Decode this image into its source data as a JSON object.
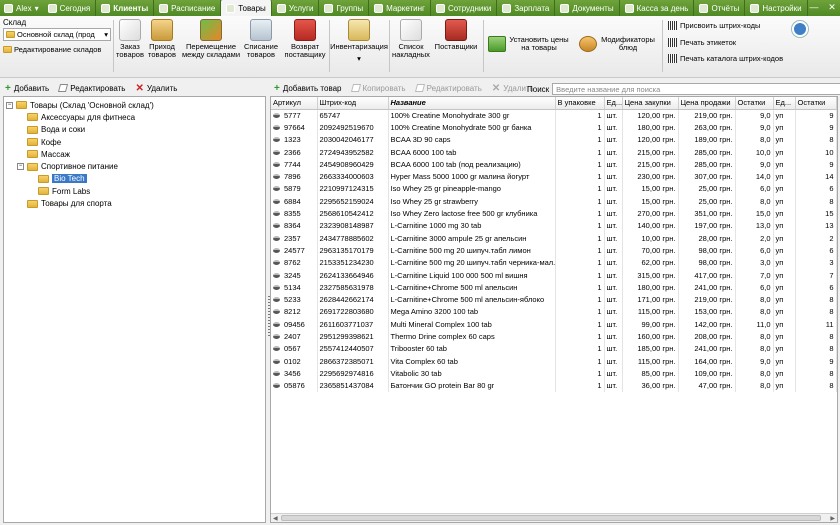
{
  "topbar": {
    "user": "Alex",
    "tabs": [
      {
        "label": "Сегодня",
        "bold": false,
        "active": false
      },
      {
        "label": "Клиенты",
        "bold": true,
        "active": false
      },
      {
        "label": "Расписание",
        "bold": false,
        "active": false
      },
      {
        "label": "Товары",
        "bold": false,
        "active": true
      },
      {
        "label": "Услуги",
        "bold": false,
        "active": false
      },
      {
        "label": "Группы",
        "bold": false,
        "active": false
      },
      {
        "label": "Маркетинг",
        "bold": false,
        "active": false
      },
      {
        "label": "Сотрудники",
        "bold": false,
        "active": false
      },
      {
        "label": "Зарплата",
        "bold": false,
        "active": false
      },
      {
        "label": "Документы",
        "bold": false,
        "active": false
      },
      {
        "label": "Касса за день",
        "bold": false,
        "active": false
      },
      {
        "label": "Отчёты",
        "bold": false,
        "active": false
      },
      {
        "label": "Настройки",
        "bold": false,
        "active": false
      }
    ]
  },
  "ribbon": {
    "sklad_label": "Склад",
    "sklad_value": "Основной склад (прод",
    "edit_sklad": "Редактирование складов",
    "buttons": {
      "order": "Заказ товаров",
      "income": "Приход товаров",
      "move": "Перемещение между складами",
      "writeoff": "Списание товаров",
      "return": "Возврат поставщику",
      "inventory": "Инвентаризация",
      "waybills": "Список накладных",
      "suppliers": "Поставщики",
      "setprices": "Установить цены на товары",
      "modifiers": "Модификаторы блюд"
    },
    "barcode_assign": "Присвоить штрих-коды",
    "print_labels": "Печать этикеток",
    "print_catalog": "Печать каталога штрих-кодов"
  },
  "left_toolbar": {
    "add": "Добавить",
    "edit": "Редактировать",
    "delete": "Удалить"
  },
  "right_toolbar": {
    "add": "Добавить товар",
    "copy": "Копировать",
    "edit": "Редактировать",
    "delete": "Удалить"
  },
  "search": {
    "label": "Поиск",
    "placeholder": "Введите название для поиска"
  },
  "tree": [
    {
      "label": "Товары (Склад 'Основной склад')",
      "level": 0,
      "exp": "−",
      "selected": false
    },
    {
      "label": "Аксессуары для фитнеса",
      "level": 1,
      "exp": "",
      "selected": false
    },
    {
      "label": "Вода и соки",
      "level": 1,
      "exp": "",
      "selected": false
    },
    {
      "label": "Кофе",
      "level": 1,
      "exp": "",
      "selected": false
    },
    {
      "label": "Массаж",
      "level": 1,
      "exp": "",
      "selected": false
    },
    {
      "label": "Спортивное питание",
      "level": 1,
      "exp": "−",
      "selected": false
    },
    {
      "label": "Bio Tech",
      "level": 2,
      "exp": "",
      "selected": true
    },
    {
      "label": "Form Labs",
      "level": 2,
      "exp": "",
      "selected": false
    },
    {
      "label": "Товары для спорта",
      "level": 1,
      "exp": "",
      "selected": false
    }
  ],
  "table": {
    "headers": [
      "Артикул",
      "Штрих-код",
      "Название",
      "В упаковке",
      "Ед...",
      "Цена закупки",
      "Цена продажи",
      "Остатки",
      "Ед...",
      "Остатки"
    ],
    "rows": [
      [
        "5777",
        "65747",
        "100% Creatine Monohydrate 300 gr",
        "1",
        "шт.",
        "120,00 грн.",
        "219,00 грн.",
        "9,0",
        "уп",
        "9"
      ],
      [
        "97664",
        "2092492519670",
        "100% Creatine Monohydrate 500 gr банка",
        "1",
        "шт.",
        "180,00 грн.",
        "263,00 грн.",
        "9,0",
        "уп",
        "9"
      ],
      [
        "1323",
        "2030042046177",
        "BCAA 3D 90 caps",
        "1",
        "шт.",
        "120,00 грн.",
        "189,00 грн.",
        "8,0",
        "уп",
        "8"
      ],
      [
        "2366",
        "2724943952582",
        "BCAA 6000 100 tab",
        "1",
        "шт.",
        "215,00 грн.",
        "285,00 грн.",
        "10,0",
        "уп",
        "10"
      ],
      [
        "7744",
        "2454908960429",
        "BCAA 6000 100 tab (под реализацию)",
        "1",
        "шт.",
        "215,00 грн.",
        "285,00 грн.",
        "9,0",
        "уп",
        "9"
      ],
      [
        "7896",
        "2663334000603",
        "Hyper Mass 5000 1000 gr малина йогурт",
        "1",
        "шт.",
        "230,00 грн.",
        "307,00 грн.",
        "14,0",
        "уп",
        "14"
      ],
      [
        "5879",
        "2210997124315",
        "Iso Whey 25 gr pineapple-mango",
        "1",
        "шт.",
        "15,00 грн.",
        "25,00 грн.",
        "6,0",
        "уп",
        "6"
      ],
      [
        "6884",
        "2295652159024",
        "Iso Whey 25 gr strawberry",
        "1",
        "шт.",
        "15,00 грн.",
        "25,00 грн.",
        "8,0",
        "уп",
        "8"
      ],
      [
        "8355",
        "2568610542412",
        "Iso Whey Zero lactose free 500 gr клубника",
        "1",
        "шт.",
        "270,00 грн.",
        "351,00 грн.",
        "15,0",
        "уп",
        "15"
      ],
      [
        "8364",
        "2323908148987",
        "L-Carnitine 1000 mg 30 tab",
        "1",
        "шт.",
        "140,00 грн.",
        "197,00 грн.",
        "13,0",
        "уп",
        "13"
      ],
      [
        "2357",
        "2434778885602",
        "L-Carnitine 3000 ampule 25 gr апельсин",
        "1",
        "шт.",
        "10,00 грн.",
        "28,00 грн.",
        "2,0",
        "уп",
        "2"
      ],
      [
        "24577",
        "2963135170179",
        "L-Carnitine 500 mg 20 шипуч.табл лимон",
        "1",
        "шт.",
        "70,00 грн.",
        "98,00 грн.",
        "6,0",
        "уп",
        "6"
      ],
      [
        "8762",
        "2153351234230",
        "L-Carnitine 500 mg 20 шипуч.табл черника-мал...",
        "1",
        "шт.",
        "62,00 грн.",
        "98,00 грн.",
        "3,0",
        "уп",
        "3"
      ],
      [
        "3245",
        "2624133664946",
        "L-Carnitine Liquid 100 000 500 ml вишня",
        "1",
        "шт.",
        "315,00 грн.",
        "417,00 грн.",
        "7,0",
        "уп",
        "7"
      ],
      [
        "5134",
        "2327585631978",
        "L-Carnitine+Chrome 500 ml апельсин",
        "1",
        "шт.",
        "180,00 грн.",
        "241,00 грн.",
        "6,0",
        "уп",
        "6"
      ],
      [
        "5233",
        "2628442662174",
        "L-Carnitine+Chrome 500 ml апельсин-яблоко",
        "1",
        "шт.",
        "171,00 грн.",
        "219,00 грн.",
        "8,0",
        "уп",
        "8"
      ],
      [
        "8212",
        "2691722803680",
        "Mega Amino 3200 100 tab",
        "1",
        "шт.",
        "115,00 грн.",
        "153,00 грн.",
        "8,0",
        "уп",
        "8"
      ],
      [
        "09456",
        "2611603771037",
        "Multi Mineral Complex 100 tab",
        "1",
        "шт.",
        "99,00 грн.",
        "142,00 грн.",
        "11,0",
        "уп",
        "11"
      ],
      [
        "2407",
        "2951299398621",
        "Thermo Drine complex 60 caps",
        "1",
        "шт.",
        "160,00 грн.",
        "208,00 грн.",
        "8,0",
        "уп",
        "8"
      ],
      [
        "0567",
        "2557412440507",
        "Tribooster 60 tab",
        "1",
        "шт.",
        "185,00 грн.",
        "241,00 грн.",
        "8,0",
        "уп",
        "8"
      ],
      [
        "0102",
        "2866372385071",
        "Vita Complex 60 tab",
        "1",
        "шт.",
        "115,00 грн.",
        "164,00 грн.",
        "9,0",
        "уп",
        "9"
      ],
      [
        "3456",
        "2295692974816",
        "Vitabolic 30 tab",
        "1",
        "шт.",
        "85,00 грн.",
        "109,00 грн.",
        "8,0",
        "уп",
        "8"
      ],
      [
        "05876",
        "2365851437084",
        "Батончик GO protein Bar 80 gr",
        "1",
        "шт.",
        "36,00 грн.",
        "47,00 грн.",
        "8,0",
        "уп",
        "8"
      ]
    ]
  }
}
